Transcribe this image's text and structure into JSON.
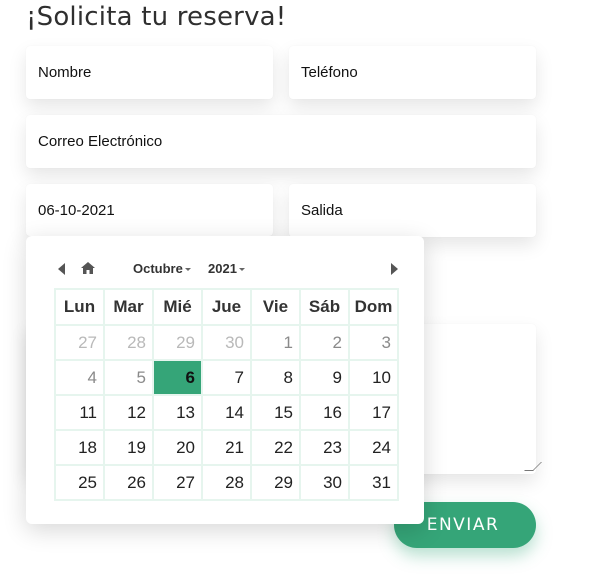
{
  "form": {
    "title": "¡Solicita tu reserva!",
    "name_placeholder": "Nombre",
    "phone_placeholder": "Teléfono",
    "email_placeholder": "Correo Electrónico",
    "arrival_value": "06-10-2021",
    "departure_placeholder": "Salida",
    "message_placeholder": "",
    "submit_label": "ENVIAR",
    "accent_color": "#35a578"
  },
  "calendar": {
    "month": "Octubre",
    "year": "2021",
    "prev_icon": "triangle-left-icon",
    "home_icon": "home-icon",
    "next_icon": "triangle-right-icon",
    "weekdays": [
      "Lun",
      "Mar",
      "Mié",
      "Jue",
      "Vie",
      "Sáb",
      "Dom"
    ],
    "weeks": [
      [
        "27",
        "28",
        "29",
        "30",
        "1",
        "2",
        "3"
      ],
      [
        "4",
        "5",
        "6",
        "7",
        "8",
        "9",
        "10"
      ],
      [
        "11",
        "12",
        "13",
        "14",
        "15",
        "16",
        "17"
      ],
      [
        "18",
        "19",
        "20",
        "21",
        "22",
        "23",
        "24"
      ],
      [
        "25",
        "26",
        "27",
        "28",
        "29",
        "30",
        "31"
      ]
    ],
    "selected_day": "6"
  }
}
